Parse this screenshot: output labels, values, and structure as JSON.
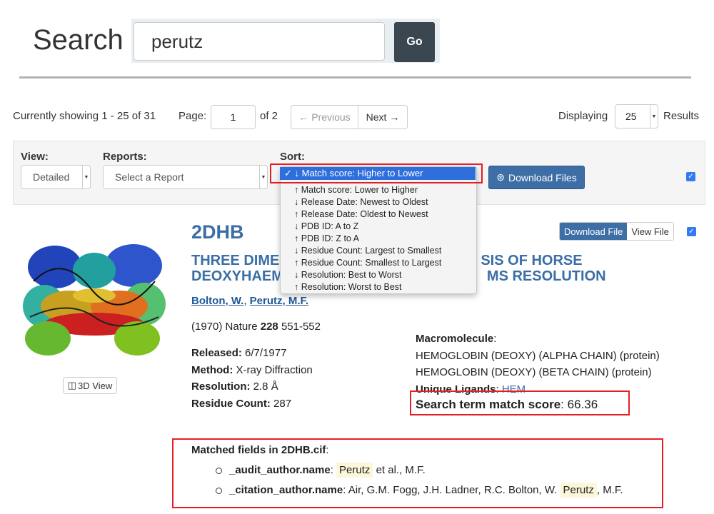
{
  "search": {
    "title": "Search",
    "query": "perutz",
    "go_label": "Go"
  },
  "pagination": {
    "showing": "Currently showing 1 - 25 of 31",
    "page_label": "Page:",
    "page_value": "1",
    "of_pages": "of 2",
    "prev_label": "← Previous",
    "next_label": "Next →",
    "displaying_label": "Displaying",
    "per_page": "25",
    "results_label": "Results"
  },
  "controls": {
    "view_label": "View:",
    "view_value": "Detailed",
    "reports_label": "Reports:",
    "reports_value": "Select a Report",
    "sort_label": "Sort:",
    "download_files_label": "Download Files",
    "sort_options": [
      "✓ ↓ Match score: Higher to Lower",
      "↑ Match score: Lower to Higher",
      "↓ Release Date: Newest to Oldest",
      "↑ Release Date: Oldest to Newest",
      "↓ PDB ID: A to Z",
      "↑ PDB ID: Z to A",
      "↓ Residue Count: Largest to Smallest",
      "↑ Residue Count: Smallest to Largest",
      "↓ Resolution: Best to Worst",
      "↑ Resolution: Worst to Best"
    ]
  },
  "entry": {
    "pdb_id": "2DHB",
    "title_line1": "THREE DIME",
    "title_line1_end": "SIS OF HORSE",
    "title_line2": "DEOXYHAEM",
    "title_line2_end": "MS RESOLUTION",
    "author1": "Bolton, W.",
    "author2": "Perutz, M.F.",
    "citation_year": "(1970) Nature",
    "citation_volume": "228",
    "citation_pages": "551-552",
    "released_label": "Released:",
    "released_value": "6/7/1977",
    "method_label": "Method:",
    "method_value": "X-ray Diffraction",
    "resolution_label": "Resolution:",
    "resolution_value": "2.8 Å",
    "residue_label": "Residue Count:",
    "residue_value": "287",
    "download_file_label": "Download File",
    "view_file_label": "View File",
    "view3d_label": "3D View",
    "macromolecule_label": "Macromolecule",
    "macro1": "HEMOGLOBIN (DEOXY) (ALPHA CHAIN) (protein)",
    "macro2": "HEMOGLOBIN (DEOXY) (BETA CHAIN) (protein)",
    "ligands_label": "Unique Ligands",
    "ligand": "HEM",
    "score_label": "Search term match score",
    "score_value": "66.36",
    "matched_label": "Matched fields in 2DHB.cif",
    "fields": [
      {
        "name": "_audit_author.name",
        "pre": "",
        "hit": "Perutz",
        "post": "et al., M.F."
      },
      {
        "name": "_citation_author.name",
        "pre": "Air, G.M. Fogg, J.H. Ladner, R.C. Bolton, W.",
        "hit": "Perutz",
        "post": ", M.F."
      }
    ]
  },
  "colors": {
    "link": "#3a6ea5",
    "primary_button": "#3d6ea6",
    "highlight_box": "#e51e25",
    "dropdown_selected": "#2f6fdc"
  }
}
